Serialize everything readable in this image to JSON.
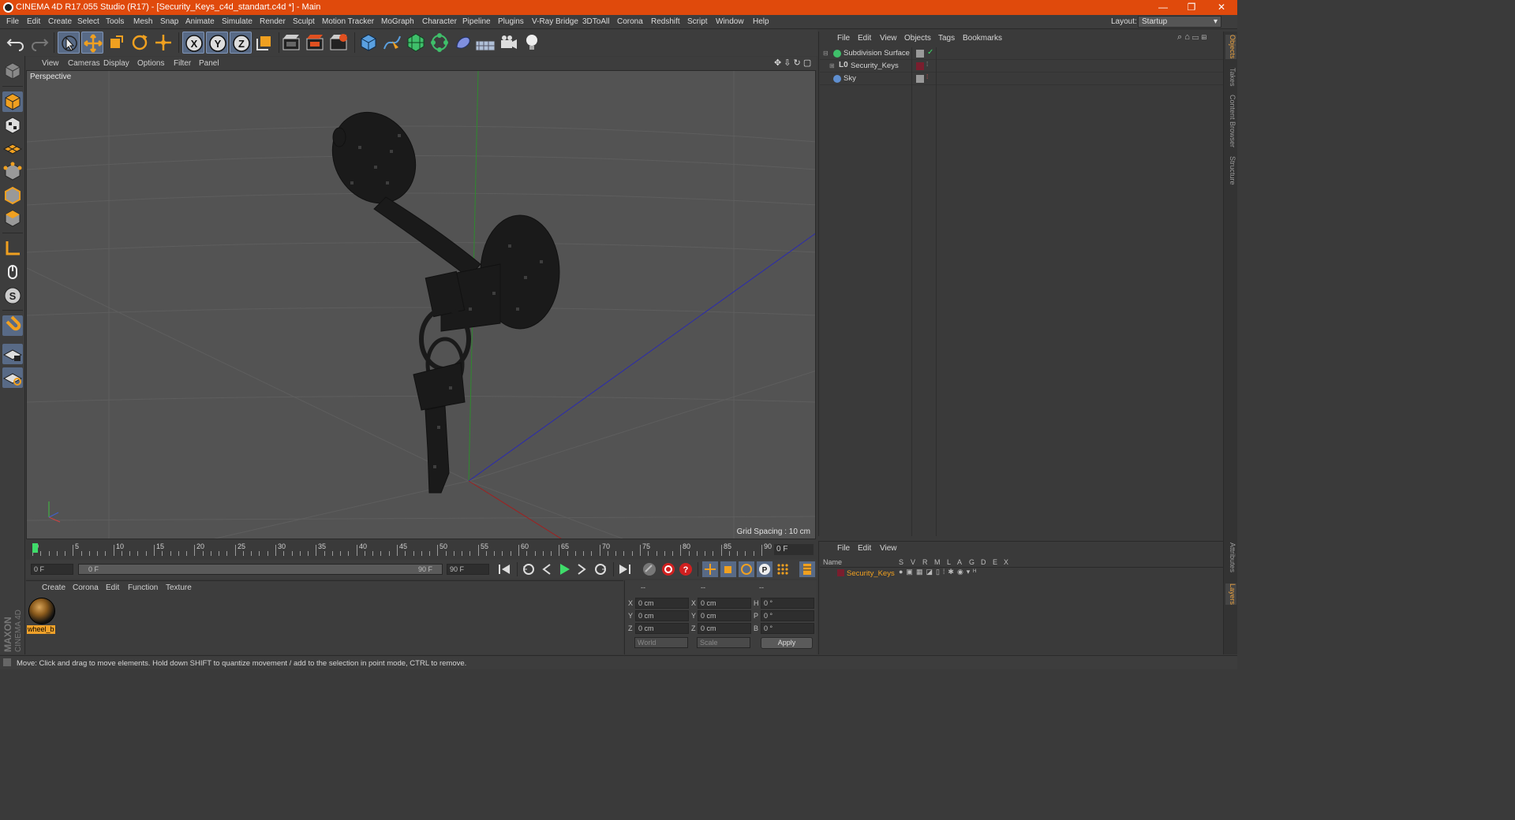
{
  "window": {
    "title": "CINEMA 4D R17.055 Studio (R17) - [Security_Keys_c4d_standart.c4d *] - Main",
    "minimize": "—",
    "restore": "❐",
    "close": "✕"
  },
  "menu": [
    "File",
    "Edit",
    "Create",
    "Select",
    "Tools",
    "Mesh",
    "Snap",
    "Animate",
    "Simulate",
    "Render",
    "Sculpt",
    "Motion Tracker",
    "MoGraph",
    "Character",
    "Pipeline",
    "Plugins",
    "V-Ray Bridge",
    "3DToAll",
    "Corona",
    "Redshift",
    "Script",
    "Window",
    "Help"
  ],
  "layout": {
    "label": "Layout:",
    "value": "Startup"
  },
  "toolbar_icons": [
    "undo-icon",
    "redo-icon",
    "select-arrow-icon",
    "move-icon",
    "scale-icon",
    "rotate-icon",
    "transform-icon",
    "x-axis-icon",
    "y-axis-icon",
    "z-axis-icon",
    "world-coord-icon",
    "render-view-icon",
    "render-picture-viewer-icon",
    "render-settings-icon",
    "cube-icon",
    "pen-spline-icon",
    "subdivision-icon",
    "array-icon",
    "deformer-icon",
    "floor-icon",
    "camera-icon",
    "light-icon"
  ],
  "viewport": {
    "menu": [
      "View",
      "Cameras",
      "Display",
      "Options",
      "Filter",
      "Panel"
    ],
    "label": "Perspective",
    "grid_spacing": "Grid Spacing : 10 cm"
  },
  "timeline": {
    "ticks": [
      "0",
      "5",
      "10",
      "15",
      "20",
      "25",
      "30",
      "35",
      "40",
      "45",
      "50",
      "55",
      "60",
      "65",
      "70",
      "75",
      "80",
      "85",
      "90"
    ],
    "frame": "0 F",
    "start": "0 F",
    "range_start": "0 F",
    "range_end": "90 F",
    "end": "90 F"
  },
  "material_manager": {
    "menu": [
      "Create",
      "Corona",
      "Edit",
      "Function",
      "Texture"
    ],
    "material_name": "wheel_b"
  },
  "branding": {
    "maxon": "MAXON",
    "product": "CINEMA 4D"
  },
  "coordinates": {
    "headers": [
      "--",
      "--",
      "--"
    ],
    "rows": [
      {
        "a": "X",
        "av": "0 cm",
        "b": "X",
        "bv": "0 cm",
        "c": "H",
        "cv": "0 °"
      },
      {
        "a": "Y",
        "av": "0 cm",
        "b": "Y",
        "bv": "0 cm",
        "c": "P",
        "cv": "0 °"
      },
      {
        "a": "Z",
        "av": "0 cm",
        "b": "Z",
        "bv": "0 cm",
        "c": "B",
        "cv": "0 °"
      }
    ],
    "mode": "World",
    "type": "Scale",
    "apply": "Apply"
  },
  "object_manager": {
    "menu": [
      "File",
      "Edit",
      "View",
      "Objects",
      "Tags",
      "Bookmarks"
    ],
    "objects": [
      {
        "name": "Subdivision Surface",
        "icon": "subdivision-icon",
        "color": "#3fbf6a"
      },
      {
        "name": "Security_Keys",
        "icon": "null-object-icon",
        "color": "#cfcfcf"
      },
      {
        "name": "Sky",
        "icon": "sky-icon",
        "color": "#5f8fd0"
      }
    ]
  },
  "layer_manager": {
    "menu": [
      "File",
      "Edit",
      "View"
    ],
    "columns": [
      "Name",
      "S",
      "V",
      "R",
      "M",
      "L",
      "A",
      "G",
      "D",
      "E",
      "X"
    ],
    "layers": [
      {
        "name": "Security_Keys",
        "color": "#7a1e2e"
      }
    ]
  },
  "side_tabs": [
    "Objects",
    "Takes",
    "Content Browser",
    "Structure",
    "Attributes",
    "Layers"
  ],
  "status": "Move: Click and drag to move elements. Hold down SHIFT to quantize movement / add to the selection in point mode, CTRL to remove."
}
